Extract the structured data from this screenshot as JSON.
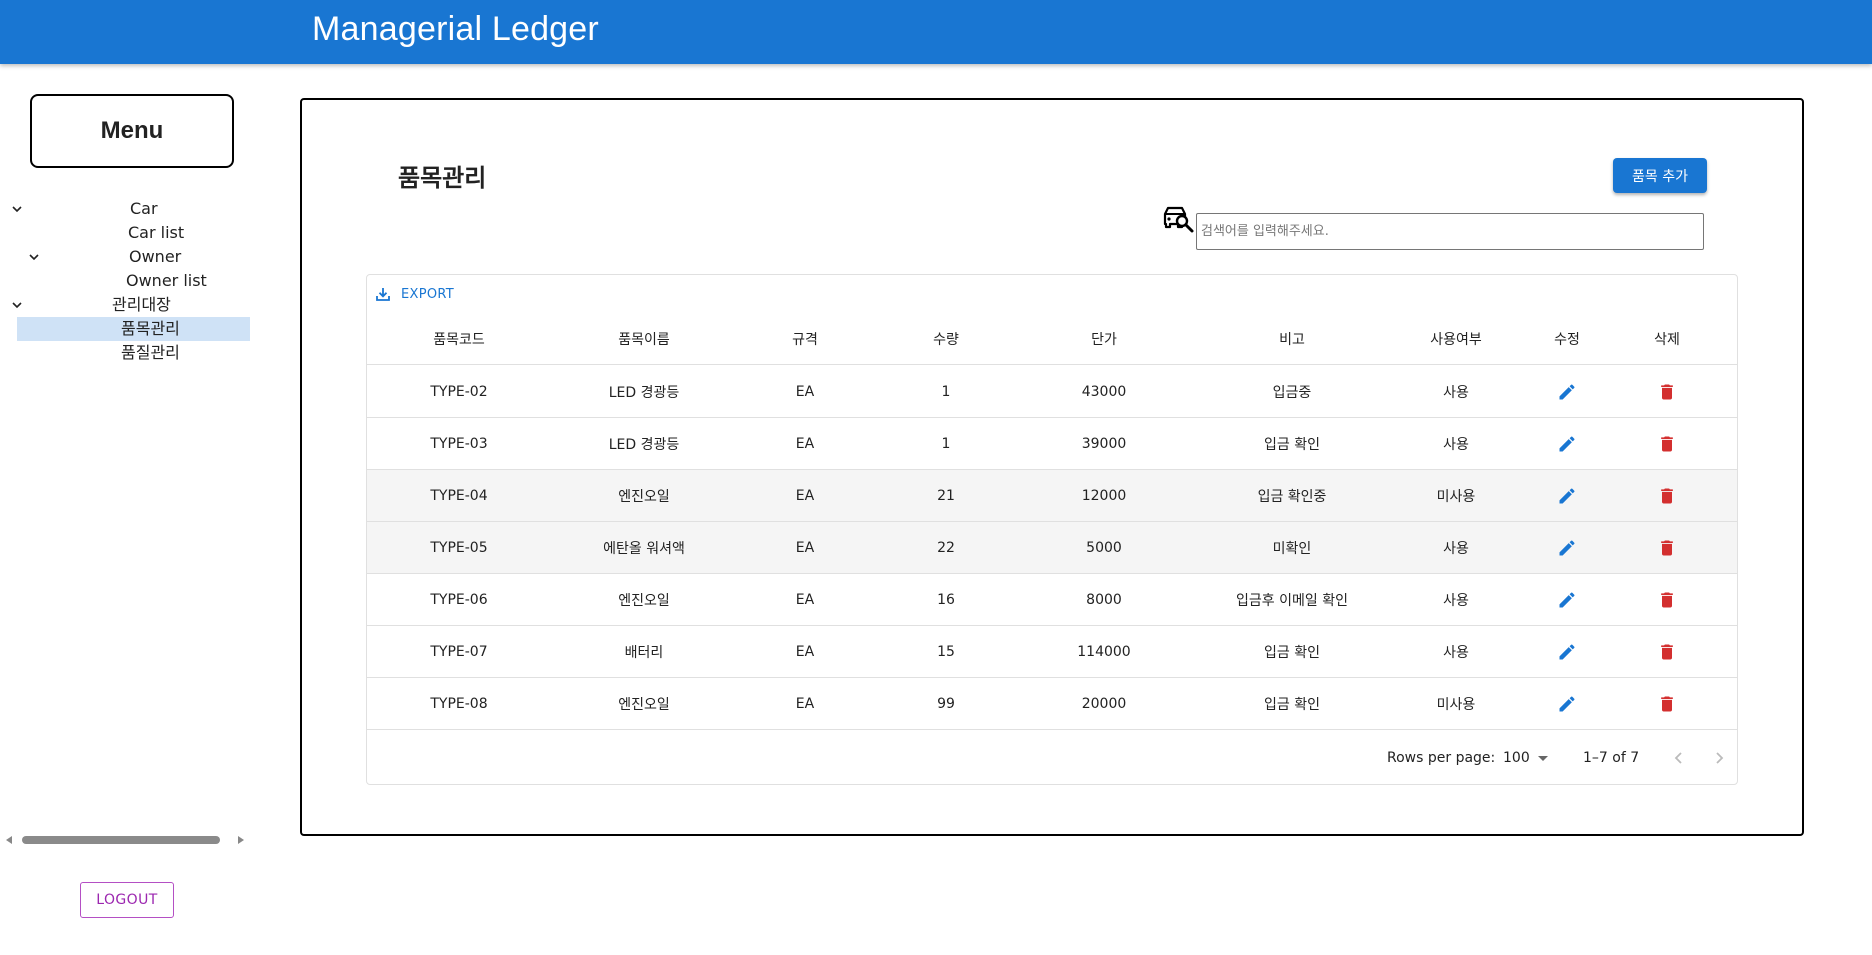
{
  "app": {
    "title": "Managerial Ledger"
  },
  "sidebar": {
    "menu_title": "Menu",
    "tree": [
      {
        "label": "Car",
        "expanded": true
      },
      {
        "label": "Car list"
      },
      {
        "label": "Owner",
        "expanded": true
      },
      {
        "label": "Owner list"
      },
      {
        "label": "관리대장",
        "expanded": true
      },
      {
        "label": "품목관리",
        "selected": true
      },
      {
        "label": "품질관리"
      }
    ],
    "logout_label": "LOGOUT"
  },
  "main": {
    "title": "품목관리",
    "add_button": "품목 추가",
    "search": {
      "placeholder": "검색어를 입력해주세요.",
      "value": ""
    }
  },
  "grid": {
    "export_label": "EXPORT",
    "columns": [
      "품목코드",
      "품목이름",
      "규격",
      "수량",
      "단가",
      "비고",
      "사용여부",
      "수정",
      "삭제"
    ],
    "rows": [
      {
        "code": "TYPE-02",
        "name": "LED 경광등",
        "spec": "EA",
        "qty": "1",
        "price": "43000",
        "note": "입금중",
        "use": "사용"
      },
      {
        "code": "TYPE-03",
        "name": "LED 경광등",
        "spec": "EA",
        "qty": "1",
        "price": "39000",
        "note": "입금 확인",
        "use": "사용"
      },
      {
        "code": "TYPE-04",
        "name": "엔진오일",
        "spec": "EA",
        "qty": "21",
        "price": "12000",
        "note": "입금 확인중",
        "use": "미사용"
      },
      {
        "code": "TYPE-05",
        "name": "에탄올 워셔액",
        "spec": "EA",
        "qty": "22",
        "price": "5000",
        "note": "미확인",
        "use": "사용"
      },
      {
        "code": "TYPE-06",
        "name": "엔진오일",
        "spec": "EA",
        "qty": "16",
        "price": "8000",
        "note": "입금후 이메일 확인",
        "use": "사용"
      },
      {
        "code": "TYPE-07",
        "name": "배터리",
        "spec": "EA",
        "qty": "15",
        "price": "114000",
        "note": "입금 확인",
        "use": "사용"
      },
      {
        "code": "TYPE-08",
        "name": "엔진오일",
        "spec": "EA",
        "qty": "99",
        "price": "20000",
        "note": "입금 확인",
        "use": "미사용"
      }
    ],
    "footer": {
      "rows_per_page_label": "Rows per page:",
      "rows_per_page_value": "100",
      "range": "1–7 of 7"
    }
  },
  "colors": {
    "primary": "#1976d2",
    "delete": "#d32f2f",
    "logout": "#9c27b0",
    "selected_bg": "#cfe2f6",
    "row_shaded": "#f5f5f5"
  },
  "icons": {
    "edit": "pencil-icon",
    "delete": "trash-icon",
    "search": "car-search-icon",
    "export": "download-icon"
  }
}
